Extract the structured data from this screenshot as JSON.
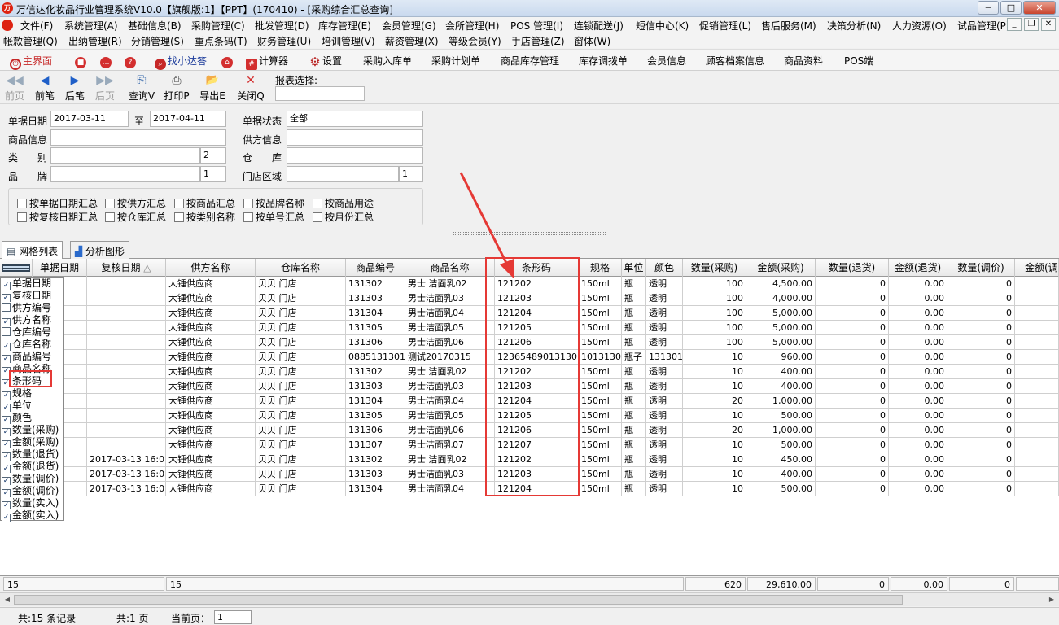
{
  "window": {
    "title": "万信达化妆品行业管理系统V10.0【旗舰版:1】【PPT】(170410) - [采购综合汇总查询]",
    "app_icon": "万",
    "controls": [
      "─",
      "□",
      "✕"
    ],
    "mdi_controls": [
      "_",
      "❐",
      "✕"
    ]
  },
  "menu_row1": [
    "文件(F)",
    "系统管理(A)",
    "基础信息(B)",
    "采购管理(C)",
    "批发管理(D)",
    "库存管理(E)",
    "会员管理(G)",
    "会所管理(H)",
    "POS 管理(I)",
    "连锁配送(J)",
    "短信中心(K)",
    "促销管理(L)",
    "售后服务(M)",
    "决策分析(N)",
    "人力资源(O)",
    "试品管理(P)"
  ],
  "menu_row2": [
    "帐款管理(Q)",
    "出纳管理(R)",
    "分销管理(S)",
    "重点条码(T)",
    "财务管理(U)",
    "培训管理(V)",
    "薪资管理(X)",
    "等级会员(Y)",
    "手店管理(Z)",
    "窗体(W)"
  ],
  "quickbar": {
    "home": "主界面",
    "find_dealer": "找小达答",
    "calculator": "计算器",
    "settings": "设置",
    "links": [
      "采购入库单",
      "采购计划单",
      "商品库存管理",
      "库存调拨单",
      "会员信息",
      "顾客档案信息",
      "商品资料",
      "POS端"
    ]
  },
  "toolbar": {
    "buttons": [
      {
        "label": "前页",
        "icon": "◀◀",
        "enabled": false
      },
      {
        "label": "前笔",
        "icon": "◀",
        "enabled": true
      },
      {
        "label": "后笔",
        "icon": "▶",
        "enabled": true
      },
      {
        "label": "后页",
        "icon": "▶▶",
        "enabled": false
      },
      {
        "label": "查询V",
        "icon": "⎘",
        "enabled": true
      },
      {
        "label": "打印P",
        "icon": "⎙",
        "enabled": true
      },
      {
        "label": "导出E",
        "icon": "📂",
        "enabled": true
      },
      {
        "label": "关闭Q",
        "icon": "✕",
        "enabled": true
      }
    ],
    "report_select_label": "报表选择:"
  },
  "filters": {
    "date_label": "单据日期",
    "date_from": "2017-03-11",
    "to_label": "至",
    "date_to": "2017-04-11",
    "status_label": "单据状态",
    "status_value": "全部",
    "product_label": "商品信息",
    "supplier_label": "供方信息",
    "category_label": "类　　别",
    "category_code": "2",
    "warehouse_label": "仓　　库",
    "brand_label": "品　　牌",
    "brand_code": "1",
    "store_area_label": "门店区域",
    "store_area_code": "1"
  },
  "group_options": [
    {
      "label": "按单据日期汇总",
      "checked": false
    },
    {
      "label": "按供方汇总",
      "checked": false
    },
    {
      "label": "按商品汇总",
      "checked": false
    },
    {
      "label": "按品牌名称",
      "checked": false
    },
    {
      "label": "按商品用途",
      "checked": false
    },
    {
      "label": "按复核日期汇总",
      "checked": false
    },
    {
      "label": "按仓库汇总",
      "checked": false
    },
    {
      "label": "按类别名称",
      "checked": false
    },
    {
      "label": "按单号汇总",
      "checked": false
    },
    {
      "label": "按月份汇总",
      "checked": false
    }
  ],
  "tabs": [
    "网格列表",
    "分析图形"
  ],
  "grid": {
    "headers": [
      "单据日期",
      "复核日期",
      "供方名称",
      "仓库名称",
      "商品编号",
      "商品名称",
      "条形码",
      "规格",
      "单位",
      "颜色",
      "数量(采购)",
      "金额(采购)",
      "数量(退货)",
      "金额(退货)",
      "数量(调价)",
      "金额(调"
    ],
    "sort_indicator": "△",
    "rows": [
      [
        "3-13",
        "",
        "大锤供应商",
        "贝贝 门店",
        "131302",
        "男士 洁面乳02",
        "121202",
        "150ml",
        "瓶",
        "透明",
        "100",
        "4,500.00",
        "0",
        "0.00",
        "0"
      ],
      [
        "3-13",
        "",
        "大锤供应商",
        "贝贝 门店",
        "131303",
        "男士洁面乳03",
        "121203",
        "150ml",
        "瓶",
        "透明",
        "100",
        "4,000.00",
        "0",
        "0.00",
        "0"
      ],
      [
        "3-13",
        "",
        "大锤供应商",
        "贝贝 门店",
        "131304",
        "男士洁面乳04",
        "121204",
        "150ml",
        "瓶",
        "透明",
        "100",
        "5,000.00",
        "0",
        "0.00",
        "0"
      ],
      [
        "3-13",
        "",
        "大锤供应商",
        "贝贝 门店",
        "131305",
        "男士洁面乳05",
        "121205",
        "150ml",
        "瓶",
        "透明",
        "100",
        "5,000.00",
        "0",
        "0.00",
        "0"
      ],
      [
        "3-13",
        "",
        "大锤供应商",
        "贝贝 门店",
        "131306",
        "男士洁面乳06",
        "121206",
        "150ml",
        "瓶",
        "透明",
        "100",
        "5,000.00",
        "0",
        "0.00",
        "0"
      ],
      [
        "4-06",
        "",
        "大锤供应商",
        "贝贝 门店",
        "0885131301",
        "测试20170315",
        "12365489013130l",
        "10131301",
        "瓶子",
        "131301",
        "10",
        "960.00",
        "0",
        "0.00",
        "0"
      ],
      [
        "4-06",
        "",
        "大锤供应商",
        "贝贝 门店",
        "131302",
        "男士 洁面乳02",
        "121202",
        "150ml",
        "瓶",
        "透明",
        "10",
        "400.00",
        "0",
        "0.00",
        "0"
      ],
      [
        "4-06",
        "",
        "大锤供应商",
        "贝贝 门店",
        "131303",
        "男士洁面乳03",
        "121203",
        "150ml",
        "瓶",
        "透明",
        "10",
        "400.00",
        "0",
        "0.00",
        "0"
      ],
      [
        "4-06",
        "",
        "大锤供应商",
        "贝贝 门店",
        "131304",
        "男士洁面乳04",
        "121204",
        "150ml",
        "瓶",
        "透明",
        "20",
        "1,000.00",
        "0",
        "0.00",
        "0"
      ],
      [
        "4-06",
        "",
        "大锤供应商",
        "贝贝 门店",
        "131305",
        "男士洁面乳05",
        "121205",
        "150ml",
        "瓶",
        "透明",
        "10",
        "500.00",
        "0",
        "0.00",
        "0"
      ],
      [
        "4-06",
        "",
        "大锤供应商",
        "贝贝 门店",
        "131306",
        "男士洁面乳06",
        "121206",
        "150ml",
        "瓶",
        "透明",
        "20",
        "1,000.00",
        "0",
        "0.00",
        "0"
      ],
      [
        "4-06",
        "",
        "大锤供应商",
        "贝贝 门店",
        "131307",
        "男士洁面乳07",
        "121207",
        "150ml",
        "瓶",
        "透明",
        "10",
        "500.00",
        "0",
        "0.00",
        "0"
      ],
      [
        "3-13",
        "2017-03-13 16:0",
        "大锤供应商",
        "贝贝 门店",
        "131302",
        "男士 洁面乳02",
        "121202",
        "150ml",
        "瓶",
        "透明",
        "10",
        "450.00",
        "0",
        "0.00",
        "0"
      ],
      [
        "3-13",
        "2017-03-13 16:0",
        "大锤供应商",
        "贝贝 门店",
        "131303",
        "男士洁面乳03",
        "121203",
        "150ml",
        "瓶",
        "透明",
        "10",
        "400.00",
        "0",
        "0.00",
        "0"
      ],
      [
        "3-13",
        "2017-03-13 16:0",
        "大锤供应商",
        "贝贝 门店",
        "131304",
        "男士洁面乳04",
        "121204",
        "150ml",
        "瓶",
        "透明",
        "10",
        "500.00",
        "0",
        "0.00",
        "0"
      ]
    ],
    "totals": {
      "row_count": "15",
      "supplier_count": "15",
      "qty_purchase": "620",
      "amt_purchase": "29,610.00",
      "qty_return": "0",
      "amt_return": "0.00",
      "qty_adjust": "0"
    }
  },
  "column_chooser": [
    {
      "label": "单据日期",
      "checked": true
    },
    {
      "label": "复核日期",
      "checked": true
    },
    {
      "label": "供方编号",
      "checked": false
    },
    {
      "label": "供方名称",
      "checked": true
    },
    {
      "label": "仓库编号",
      "checked": false
    },
    {
      "label": "仓库名称",
      "checked": true
    },
    {
      "label": "商品编号",
      "checked": true
    },
    {
      "label": "商品名称",
      "checked": true
    },
    {
      "label": "条形码",
      "checked": true
    },
    {
      "label": "规格",
      "checked": true
    },
    {
      "label": "单位",
      "checked": true
    },
    {
      "label": "颜色",
      "checked": true
    },
    {
      "label": "数量(采购)",
      "checked": true
    },
    {
      "label": "金额(采购)",
      "checked": true
    },
    {
      "label": "数量(退货)",
      "checked": true
    },
    {
      "label": "金额(退货)",
      "checked": true
    },
    {
      "label": "数量(调价)",
      "checked": true
    },
    {
      "label": "金额(调价)",
      "checked": true
    },
    {
      "label": "数量(实入)",
      "checked": true
    },
    {
      "label": "金额(实入)",
      "checked": true
    }
  ],
  "statusbar": {
    "records": "共:15 条记录",
    "pages": "共:1 页",
    "current_page_label": "当前页：",
    "current_page": "1"
  },
  "colors": {
    "highlight": "#e53935",
    "menu_bg": "#f3f3f3",
    "grid_header": "#ececec"
  }
}
